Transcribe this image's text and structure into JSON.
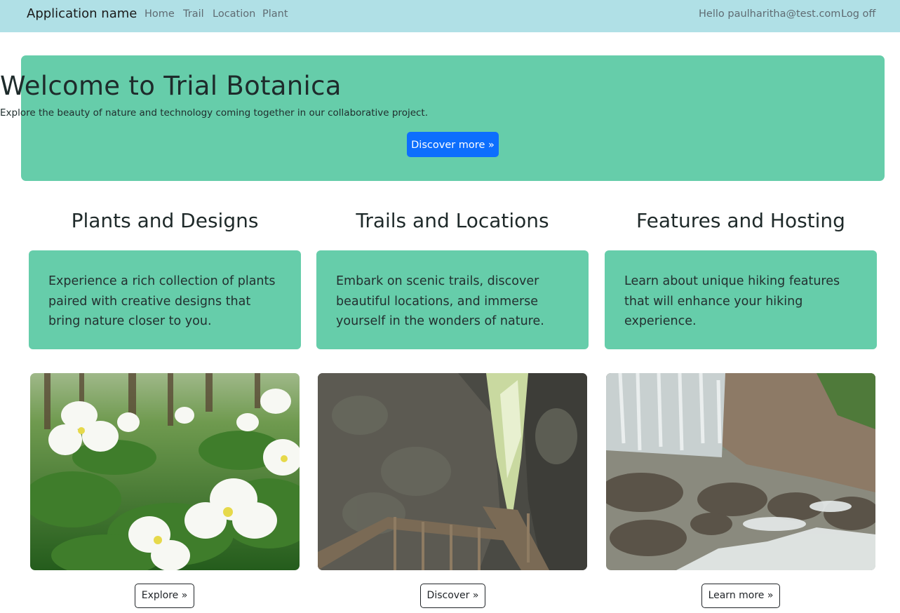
{
  "navbar": {
    "brand": "Application name",
    "links": [
      "Home",
      "Trail",
      "Location",
      "Plant"
    ],
    "greeting": "Hello paulharitha@test.com!",
    "logoff": "Log off"
  },
  "hero": {
    "title": "Welcome to Trial Botanica",
    "subtitle": "Explore the beauty of nature and technology coming together in our collaborative project.",
    "button": "Discover more »"
  },
  "columns": [
    {
      "heading": "Plants and Designs",
      "text": "Experience a rich collection of plants paired with creative designs that bring nature closer to you.",
      "image_icon": "trillium-flowers-photo",
      "button": "Explore »"
    },
    {
      "heading": "Trails and Locations",
      "text": "Embark on scenic trails, discover beautiful locations, and immerse yourself in the wonders of nature.",
      "image_icon": "canyon-boardwalk-photo",
      "button": "Discover »"
    },
    {
      "heading": "Features and Hosting",
      "text": "Learn about unique hiking features that will enhance your hiking experience.",
      "image_icon": "waterfall-photo",
      "button": "Learn more »"
    }
  ],
  "colors": {
    "navbar": "#b0e0e6",
    "accent_green": "#66cdaa",
    "primary_button": "#0d6efd"
  }
}
